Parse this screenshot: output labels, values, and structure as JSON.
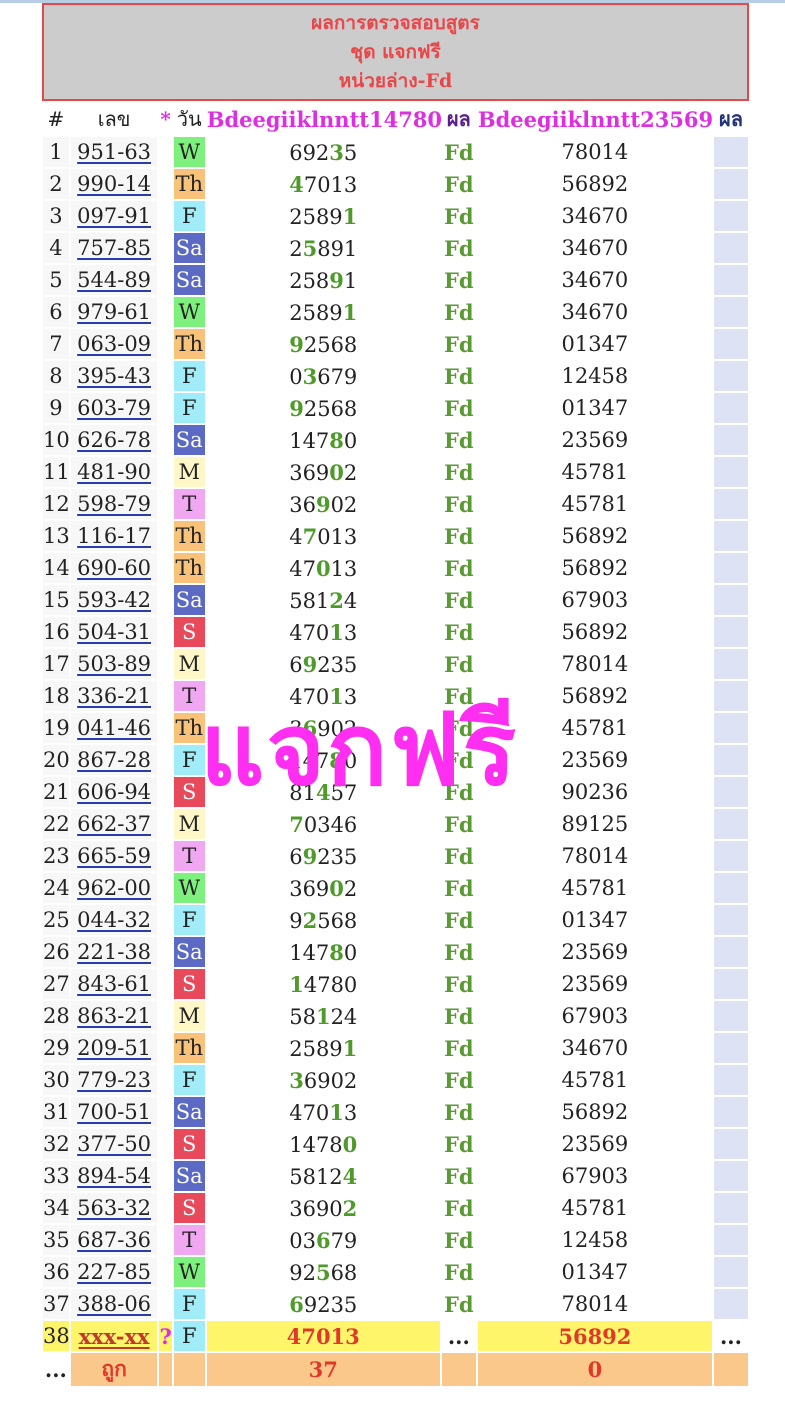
{
  "header": {
    "line1": "ผลการตรวจสอบสูตร",
    "line2": "ชุด แจกฟรี",
    "line3": "หน่วยล่าง-Fd"
  },
  "columns": {
    "num": "#",
    "lek": "เลข",
    "star": "*",
    "day": "วัน",
    "formula1": "Bdeegiiklnntt14780",
    "result1": "ผล",
    "formula2": "Bdeegiiklnntt23569",
    "result2": "ผล"
  },
  "rows": [
    {
      "n": "1",
      "lek": "951-63",
      "day": "W",
      "f1a": "692",
      "f1b": "3",
      "f1c": "5",
      "res": "Fd",
      "f2": "78014"
    },
    {
      "n": "2",
      "lek": "990-14",
      "day": "Th",
      "f1a": "",
      "f1b": "4",
      "f1c": "7013",
      "res": "Fd",
      "f2": "56892"
    },
    {
      "n": "3",
      "lek": "097-91",
      "day": "F",
      "f1a": "2589",
      "f1b": "1",
      "f1c": "",
      "res": "Fd",
      "f2": "34670"
    },
    {
      "n": "4",
      "lek": "757-85",
      "day": "Sa",
      "f1a": "2",
      "f1b": "5",
      "f1c": "891",
      "res": "Fd",
      "f2": "34670"
    },
    {
      "n": "5",
      "lek": "544-89",
      "day": "Sa",
      "f1a": "258",
      "f1b": "9",
      "f1c": "1",
      "res": "Fd",
      "f2": "34670"
    },
    {
      "n": "6",
      "lek": "979-61",
      "day": "W",
      "f1a": "2589",
      "f1b": "1",
      "f1c": "",
      "res": "Fd",
      "f2": "34670"
    },
    {
      "n": "7",
      "lek": "063-09",
      "day": "Th",
      "f1a": "",
      "f1b": "9",
      "f1c": "2568",
      "res": "Fd",
      "f2": "01347"
    },
    {
      "n": "8",
      "lek": "395-43",
      "day": "F",
      "f1a": "0",
      "f1b": "3",
      "f1c": "679",
      "res": "Fd",
      "f2": "12458"
    },
    {
      "n": "9",
      "lek": "603-79",
      "day": "F",
      "f1a": "",
      "f1b": "9",
      "f1c": "2568",
      "res": "Fd",
      "f2": "01347"
    },
    {
      "n": "10",
      "lek": "626-78",
      "day": "Sa",
      "f1a": "147",
      "f1b": "8",
      "f1c": "0",
      "res": "Fd",
      "f2": "23569"
    },
    {
      "n": "11",
      "lek": "481-90",
      "day": "M",
      "f1a": "369",
      "f1b": "0",
      "f1c": "2",
      "res": "Fd",
      "f2": "45781"
    },
    {
      "n": "12",
      "lek": "598-79",
      "day": "T",
      "f1a": "36",
      "f1b": "9",
      "f1c": "02",
      "res": "Fd",
      "f2": "45781"
    },
    {
      "n": "13",
      "lek": "116-17",
      "day": "Th",
      "f1a": "4",
      "f1b": "7",
      "f1c": "013",
      "res": "Fd",
      "f2": "56892"
    },
    {
      "n": "14",
      "lek": "690-60",
      "day": "Th",
      "f1a": "47",
      "f1b": "0",
      "f1c": "13",
      "res": "Fd",
      "f2": "56892"
    },
    {
      "n": "15",
      "lek": "593-42",
      "day": "Sa",
      "f1a": "581",
      "f1b": "2",
      "f1c": "4",
      "res": "Fd",
      "f2": "67903"
    },
    {
      "n": "16",
      "lek": "504-31",
      "day": "S",
      "f1a": "470",
      "f1b": "1",
      "f1c": "3",
      "res": "Fd",
      "f2": "56892"
    },
    {
      "n": "17",
      "lek": "503-89",
      "day": "M",
      "f1a": "6",
      "f1b": "9",
      "f1c": "235",
      "res": "Fd",
      "f2": "78014"
    },
    {
      "n": "18",
      "lek": "336-21",
      "day": "T",
      "f1a": "470",
      "f1b": "1",
      "f1c": "3",
      "res": "Fd",
      "f2": "56892"
    },
    {
      "n": "19",
      "lek": "041-46",
      "day": "Th",
      "f1a": "3",
      "f1b": "6",
      "f1c": "902",
      "res": "Fd",
      "f2": "45781"
    },
    {
      "n": "20",
      "lek": "867-28",
      "day": "F",
      "f1a": "147",
      "f1b": "8",
      "f1c": "0",
      "res": "Fd",
      "f2": "23569"
    },
    {
      "n": "21",
      "lek": "606-94",
      "day": "S",
      "f1a": "81",
      "f1b": "4",
      "f1c": "57",
      "res": "Fd",
      "f2": "90236"
    },
    {
      "n": "22",
      "lek": "662-37",
      "day": "M",
      "f1a": "",
      "f1b": "7",
      "f1c": "0346",
      "res": "Fd",
      "f2": "89125"
    },
    {
      "n": "23",
      "lek": "665-59",
      "day": "T",
      "f1a": "6",
      "f1b": "9",
      "f1c": "235",
      "res": "Fd",
      "f2": "78014"
    },
    {
      "n": "24",
      "lek": "962-00",
      "day": "W",
      "f1a": "369",
      "f1b": "0",
      "f1c": "2",
      "res": "Fd",
      "f2": "45781"
    },
    {
      "n": "25",
      "lek": "044-32",
      "day": "F",
      "f1a": "9",
      "f1b": "2",
      "f1c": "568",
      "res": "Fd",
      "f2": "01347"
    },
    {
      "n": "26",
      "lek": "221-38",
      "day": "Sa",
      "f1a": "147",
      "f1b": "8",
      "f1c": "0",
      "res": "Fd",
      "f2": "23569"
    },
    {
      "n": "27",
      "lek": "843-61",
      "day": "S",
      "f1a": "",
      "f1b": "1",
      "f1c": "4780",
      "res": "Fd",
      "f2": "23569"
    },
    {
      "n": "28",
      "lek": "863-21",
      "day": "M",
      "f1a": "58",
      "f1b": "1",
      "f1c": "24",
      "res": "Fd",
      "f2": "67903"
    },
    {
      "n": "29",
      "lek": "209-51",
      "day": "Th",
      "f1a": "2589",
      "f1b": "1",
      "f1c": "",
      "res": "Fd",
      "f2": "34670"
    },
    {
      "n": "30",
      "lek": "779-23",
      "day": "F",
      "f1a": "",
      "f1b": "3",
      "f1c": "6902",
      "res": "Fd",
      "f2": "45781"
    },
    {
      "n": "31",
      "lek": "700-51",
      "day": "Sa",
      "f1a": "470",
      "f1b": "1",
      "f1c": "3",
      "res": "Fd",
      "f2": "56892"
    },
    {
      "n": "32",
      "lek": "377-50",
      "day": "S",
      "f1a": "1478",
      "f1b": "0",
      "f1c": "",
      "res": "Fd",
      "f2": "23569"
    },
    {
      "n": "33",
      "lek": "894-54",
      "day": "Sa",
      "f1a": "5812",
      "f1b": "4",
      "f1c": "",
      "res": "Fd",
      "f2": "67903"
    },
    {
      "n": "34",
      "lek": "563-32",
      "day": "S",
      "f1a": "3690",
      "f1b": "2",
      "f1c": "",
      "res": "Fd",
      "f2": "45781"
    },
    {
      "n": "35",
      "lek": "687-36",
      "day": "T",
      "f1a": "03",
      "f1b": "6",
      "f1c": "79",
      "res": "Fd",
      "f2": "12458"
    },
    {
      "n": "36",
      "lek": "227-85",
      "day": "W",
      "f1a": "92",
      "f1b": "5",
      "f1c": "68",
      "res": "Fd",
      "f2": "01347"
    },
    {
      "n": "37",
      "lek": "388-06",
      "day": "F",
      "f1a": "",
      "f1b": "6",
      "f1c": "9235",
      "res": "Fd",
      "f2": "78014"
    }
  ],
  "pending": {
    "n": "38",
    "lek": "xxx-xx",
    "star": "?",
    "day": "F",
    "f1": "47013",
    "res1": "...",
    "f2": "56892",
    "res2": "..."
  },
  "totals": {
    "first": "...",
    "label": "ถูก",
    "f1": "37",
    "f2": "0"
  },
  "watermark": "แจกฟรี",
  "colors": {
    "header_text": "#e8474a",
    "formula_header": "#dd2fe0",
    "result": "#5a9a34",
    "highlight_digit": "#4e9a2a",
    "watermark": "#ff2ef0"
  }
}
